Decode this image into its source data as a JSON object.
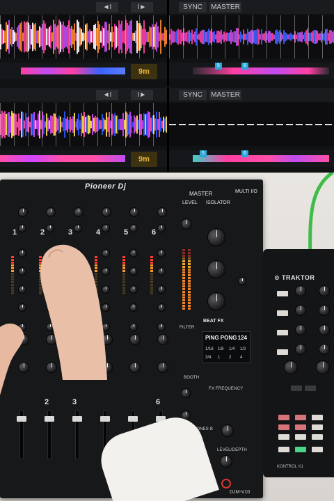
{
  "traktor_screen": {
    "decks": [
      {
        "id": "deck-a",
        "top_buttons": [
          "◄I",
          "I►"
        ],
        "time_label": "9m",
        "waveform_palette": [
          "#ff3fa2",
          "#ff8a2a",
          "#c04df0",
          "#ffffff"
        ]
      },
      {
        "id": "deck-b",
        "top_buttons": [
          "SYNC",
          "MASTER"
        ],
        "cue_markers": [
          "5",
          "6"
        ],
        "waveform_palette": [
          "#3b62ff",
          "#c04df0",
          "#ff3fa2"
        ]
      },
      {
        "id": "deck-c",
        "top_buttons": [
          "◄I",
          "I►"
        ],
        "time_label": "9m",
        "waveform_palette": [
          "#2f58ff",
          "#d046ff",
          "#ff4fa8",
          "#ffe64a"
        ]
      },
      {
        "id": "deck-d",
        "top_buttons": [
          "SYNC",
          "MASTER"
        ],
        "cue_markers": [
          "5",
          "6"
        ],
        "waveform_palette": [
          "#e2e2e2",
          "#ff4fa8"
        ]
      }
    ]
  },
  "mixer": {
    "logo": "Pioneer Dj",
    "model": "DJM-V10",
    "master_label": "MASTER",
    "multi_io_label": "MULTI I/O",
    "level_label": "LEVEL",
    "isolator_label": "ISOLATOR",
    "channels": [
      "1",
      "2",
      "3",
      "4",
      "5",
      "6"
    ],
    "bottom_channel_labels": [
      "2",
      "3",
      "6"
    ],
    "beat_fx_label": "BEAT FX",
    "fx_frequency_label": "FX FREQUENCY",
    "booth_label": "BOOTH",
    "headphones_label": "HEADPHONES B",
    "level_depth_label": "LEVEL/DEPTH",
    "filter_label": "FILTER",
    "lcd": {
      "title": "PING PONG",
      "bpm": "124",
      "beats": [
        "1/16",
        "1/8",
        "1/4",
        "1/2"
      ],
      "beats2": [
        "3/4",
        "1",
        "2",
        "4"
      ]
    }
  },
  "controller": {
    "brand": "TRAKTOR",
    "model": "KONTROL X1"
  },
  "colors": {
    "screen_bg": "#111214",
    "mixer_body": "#17181a",
    "accent_pink": "#ff3fa2",
    "accent_blue": "#3b62ff",
    "time_badge": "#e6b33c",
    "cue_blue": "#2aa7d6",
    "cable_green": "#3fbd4a"
  }
}
